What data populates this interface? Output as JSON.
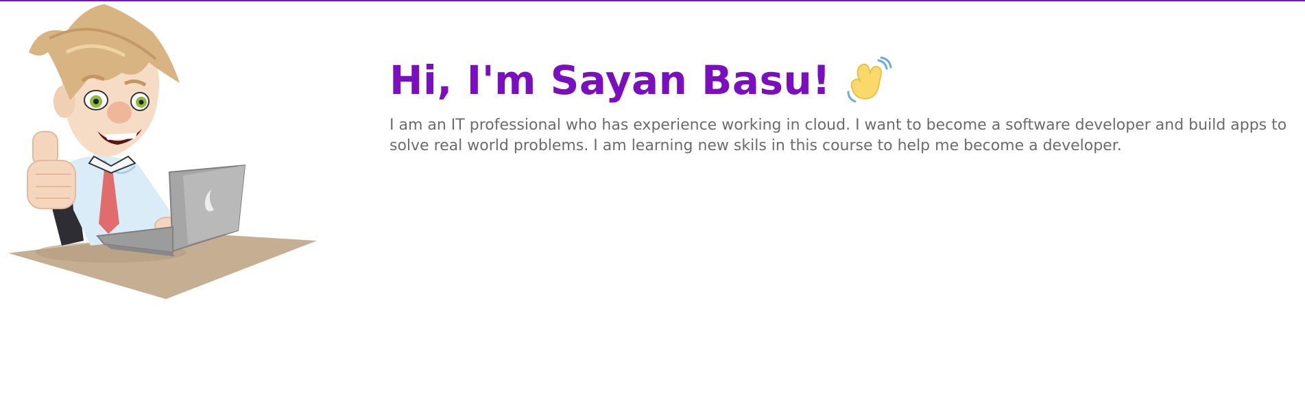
{
  "header": {
    "greeting": "Hi, I'm Sayan Basu!",
    "greeting_icon": "waving-hand-icon"
  },
  "intro": {
    "bio": "I am an IT professional who has experience working in cloud. I want to become a software developer and build apps to solve real world problems. I am learning new skils in this course to help me become a developer."
  },
  "illustration": {
    "name": "developer-with-laptop-illustration"
  },
  "colors": {
    "accent": "#7a12c0",
    "body_text": "#6b6b6b",
    "background": "#ffffff"
  }
}
